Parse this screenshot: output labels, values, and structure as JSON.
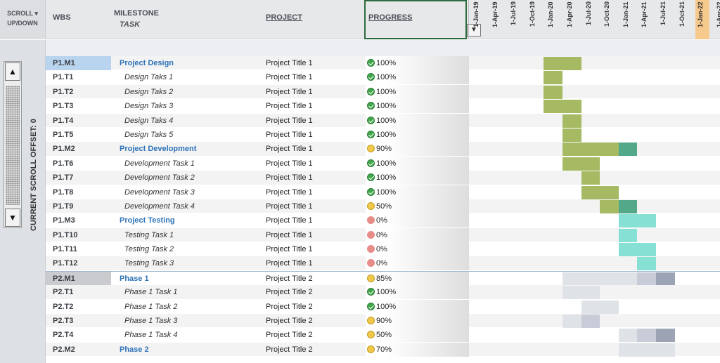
{
  "header": {
    "scroll_label": "SCROLL ▾ UP/DOWN",
    "wbs": "WBS",
    "milestone": "MILESTONE",
    "task": "TASK",
    "project": "PROJECT",
    "progress": "PROGRESS",
    "filter_icon": "▼"
  },
  "scroll": {
    "up": "▲",
    "down": "▼",
    "offset_label": "CURRENT SCROLL OFFSET: 0"
  },
  "timeline": {
    "ticks": [
      "1-Jan-19",
      "1-Apr-19",
      "1-Jul-19",
      "1-Oct-19",
      "1-Jan-20",
      "1-Apr-20",
      "1-Jul-20",
      "1-Oct-20",
      "1-Jan-21",
      "1-Apr-21",
      "1-Jul-21",
      "1-Oct-21",
      "1-Jan-22",
      "1-Apr-22"
    ],
    "highlight_index": 12
  },
  "colors": {
    "green": "#a5ba63",
    "teal_dark": "#52a889",
    "teal_light": "#86e0d3",
    "gray_light": "#dfe2e7",
    "gray_mid": "#c8ccd8",
    "gray_dark": "#9ba3b4"
  },
  "rows": [
    {
      "wbs": "P1.M1",
      "name": "Project Design",
      "type": "ms",
      "project": "Project Title 1",
      "progress": "100%",
      "status": "done",
      "wbs_style": "hl",
      "bars": [
        {
          "s": 4,
          "e": 6,
          "c": "green"
        }
      ]
    },
    {
      "wbs": "P1.T1",
      "name": "Design Taks 1",
      "type": "task",
      "project": "Project Title 1",
      "progress": "100%",
      "status": "done",
      "bars": [
        {
          "s": 4,
          "e": 5,
          "c": "green"
        }
      ]
    },
    {
      "wbs": "P1.T2",
      "name": "Design Taks 2",
      "type": "task",
      "project": "Project Title 1",
      "progress": "100%",
      "status": "done",
      "bars": [
        {
          "s": 4,
          "e": 5,
          "c": "green"
        }
      ]
    },
    {
      "wbs": "P1.T3",
      "name": "Design Taks 3",
      "type": "task",
      "project": "Project Title 1",
      "progress": "100%",
      "status": "done",
      "bars": [
        {
          "s": 4,
          "e": 6,
          "c": "green"
        }
      ]
    },
    {
      "wbs": "P1.T4",
      "name": "Design Taks 4",
      "type": "task",
      "project": "Project Title 1",
      "progress": "100%",
      "status": "done",
      "bars": [
        {
          "s": 5,
          "e": 6,
          "c": "green"
        }
      ]
    },
    {
      "wbs": "P1.T5",
      "name": "Design Taks 5",
      "type": "task",
      "project": "Project Title 1",
      "progress": "100%",
      "status": "done",
      "bars": [
        {
          "s": 5,
          "e": 6,
          "c": "green"
        }
      ]
    },
    {
      "wbs": "P1.M2",
      "name": "Project Development",
      "type": "ms",
      "project": "Project Title 1",
      "progress": "90%",
      "status": "half",
      "bars": [
        {
          "s": 5,
          "e": 8,
          "c": "green"
        },
        {
          "s": 8,
          "e": 9,
          "c": "teal_dark"
        }
      ]
    },
    {
      "wbs": "P1.T6",
      "name": "Development Task 1",
      "type": "task",
      "project": "Project Title 1",
      "progress": "100%",
      "status": "done",
      "bars": [
        {
          "s": 5,
          "e": 7,
          "c": "green"
        }
      ]
    },
    {
      "wbs": "P1.T7",
      "name": "Development Task 2",
      "type": "task",
      "project": "Project Title 1",
      "progress": "100%",
      "status": "done",
      "bars": [
        {
          "s": 6,
          "e": 7,
          "c": "green"
        }
      ]
    },
    {
      "wbs": "P1.T8",
      "name": "Development Task 3",
      "type": "task",
      "project": "Project Title 1",
      "progress": "100%",
      "status": "done",
      "bars": [
        {
          "s": 6,
          "e": 8,
          "c": "green"
        }
      ]
    },
    {
      "wbs": "P1.T9",
      "name": "Development Task 4",
      "type": "task",
      "project": "Project Title 1",
      "progress": "50%",
      "status": "half",
      "bars": [
        {
          "s": 7,
          "e": 8,
          "c": "green"
        },
        {
          "s": 8,
          "e": 9,
          "c": "teal_dark"
        }
      ]
    },
    {
      "wbs": "P1.M3",
      "name": "Project Testing",
      "type": "ms",
      "project": "Project Title 1",
      "progress": "0%",
      "status": "none",
      "bars": [
        {
          "s": 8,
          "e": 10,
          "c": "teal_light"
        }
      ]
    },
    {
      "wbs": "P1.T10",
      "name": "Testing Task 1",
      "type": "task",
      "project": "Project Title 1",
      "progress": "0%",
      "status": "none",
      "bars": [
        {
          "s": 8,
          "e": 9,
          "c": "teal_light"
        }
      ]
    },
    {
      "wbs": "P1.T11",
      "name": "Testing Task 2",
      "type": "task",
      "project": "Project Title 1",
      "progress": "0%",
      "status": "none",
      "bars": [
        {
          "s": 8,
          "e": 10,
          "c": "teal_light"
        }
      ]
    },
    {
      "wbs": "P1.T12",
      "name": "Testing Task 3",
      "type": "task",
      "project": "Project Title 1",
      "progress": "0%",
      "status": "none",
      "bars": [
        {
          "s": 9,
          "e": 10,
          "c": "teal_light"
        }
      ]
    },
    {
      "wbs": "P2.M1",
      "name": "Phase 1",
      "type": "ms",
      "project": "Project Title 2",
      "progress": "85%",
      "status": "half",
      "wbs_style": "gray",
      "sep": true,
      "bars": [
        {
          "s": 5,
          "e": 9,
          "c": "gray_light"
        },
        {
          "s": 9,
          "e": 10,
          "c": "gray_mid"
        },
        {
          "s": 10,
          "e": 11,
          "c": "gray_dark"
        }
      ]
    },
    {
      "wbs": "P2.T1",
      "name": "Phase 1 Task 1",
      "type": "task",
      "project": "Project Title 2",
      "progress": "100%",
      "status": "done",
      "bars": [
        {
          "s": 5,
          "e": 7,
          "c": "gray_light"
        }
      ]
    },
    {
      "wbs": "P2.T2",
      "name": "Phase 1 Task 2",
      "type": "task",
      "project": "Project Title 2",
      "progress": "100%",
      "status": "done",
      "bars": [
        {
          "s": 6,
          "e": 8,
          "c": "gray_light"
        }
      ]
    },
    {
      "wbs": "P2.T3",
      "name": "Phase 1 Task 3",
      "type": "task",
      "project": "Project Title 2",
      "progress": "90%",
      "status": "half",
      "bars": [
        {
          "s": 5,
          "e": 6,
          "c": "gray_light"
        },
        {
          "s": 6,
          "e": 7,
          "c": "gray_mid"
        }
      ]
    },
    {
      "wbs": "P2.T4",
      "name": "Phase 1 Task 4",
      "type": "task",
      "project": "Project Title 2",
      "progress": "50%",
      "status": "half",
      "bars": [
        {
          "s": 8,
          "e": 9,
          "c": "gray_light"
        },
        {
          "s": 9,
          "e": 10,
          "c": "gray_mid"
        },
        {
          "s": 10,
          "e": 11,
          "c": "gray_dark"
        }
      ]
    },
    {
      "wbs": "P2.M2",
      "name": "Phase 2",
      "type": "ms",
      "project": "Project Title 2",
      "progress": "70%",
      "status": "half",
      "bars": [
        {
          "s": 8,
          "e": 11,
          "c": "gray_light"
        }
      ]
    }
  ]
}
